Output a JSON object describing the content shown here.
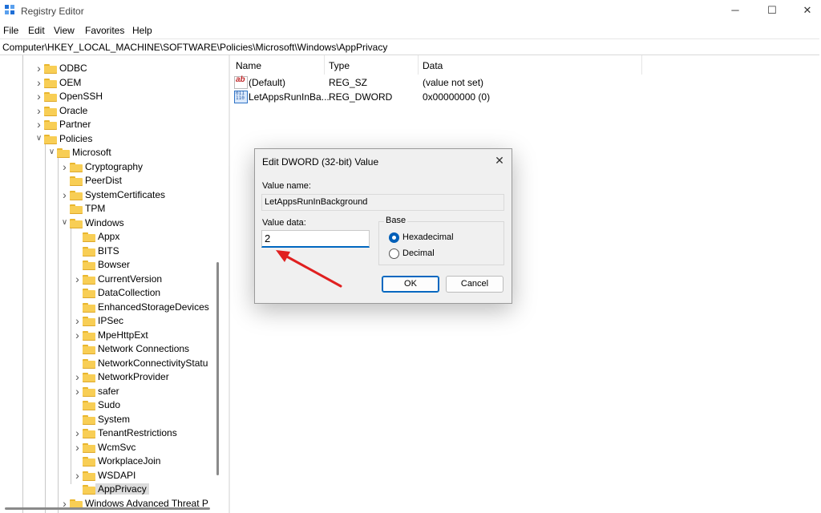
{
  "window": {
    "title": "Registry Editor",
    "minimize": "─",
    "maximize": "☐",
    "close": "✕"
  },
  "menu": [
    "File",
    "Edit",
    "View",
    "Favorites",
    "Help"
  ],
  "address": "Computer\\HKEY_LOCAL_MACHINE\\SOFTWARE\\Policies\\Microsoft\\Windows\\AppPrivacy",
  "tree": [
    {
      "label": "ODBC"
    },
    {
      "label": "OEM"
    },
    {
      "label": "OpenSSH"
    },
    {
      "label": "Oracle"
    },
    {
      "label": "Partner"
    },
    {
      "label": "Policies"
    },
    {
      "label": "Microsoft"
    },
    {
      "label": "Cryptography"
    },
    {
      "label": "PeerDist"
    },
    {
      "label": "SystemCertificates"
    },
    {
      "label": "TPM"
    },
    {
      "label": "Windows"
    },
    {
      "label": "Appx"
    },
    {
      "label": "BITS"
    },
    {
      "label": "Bowser"
    },
    {
      "label": "CurrentVersion"
    },
    {
      "label": "DataCollection"
    },
    {
      "label": "EnhancedStorageDevices"
    },
    {
      "label": "IPSec"
    },
    {
      "label": "MpeHttpExt"
    },
    {
      "label": "Network Connections"
    },
    {
      "label": "NetworkConnectivityStatu"
    },
    {
      "label": "NetworkProvider"
    },
    {
      "label": "safer"
    },
    {
      "label": "Sudo"
    },
    {
      "label": "System"
    },
    {
      "label": "TenantRestrictions"
    },
    {
      "label": "WcmSvc"
    },
    {
      "label": "WorkplaceJoin"
    },
    {
      "label": "WSDAPI"
    },
    {
      "label": "AppPrivacy"
    },
    {
      "label": "Windows Advanced Threat P"
    }
  ],
  "columns": {
    "name": "Name",
    "type": "Type",
    "data": "Data"
  },
  "values": [
    {
      "icon": "ab",
      "name": "(Default)",
      "type": "REG_SZ",
      "data": "(value not set)"
    },
    {
      "icon": "011\n110",
      "name": "LetAppsRunInBa...",
      "type": "REG_DWORD",
      "data": "0x00000000 (0)"
    }
  ],
  "dialog": {
    "title": "Edit DWORD (32-bit) Value",
    "close": "✕",
    "value_name_label": "Value name:",
    "value_name": "LetAppsRunInBackground",
    "value_data_label": "Value data:",
    "value_data": "2",
    "base_label": "Base",
    "hex_label": "Hexadecimal",
    "dec_label": "Decimal",
    "ok_label": "OK",
    "cancel_label": "Cancel"
  },
  "colors": {
    "accent": "#0067c0",
    "arrow": "#e02020",
    "folder": "#f8ce55"
  }
}
